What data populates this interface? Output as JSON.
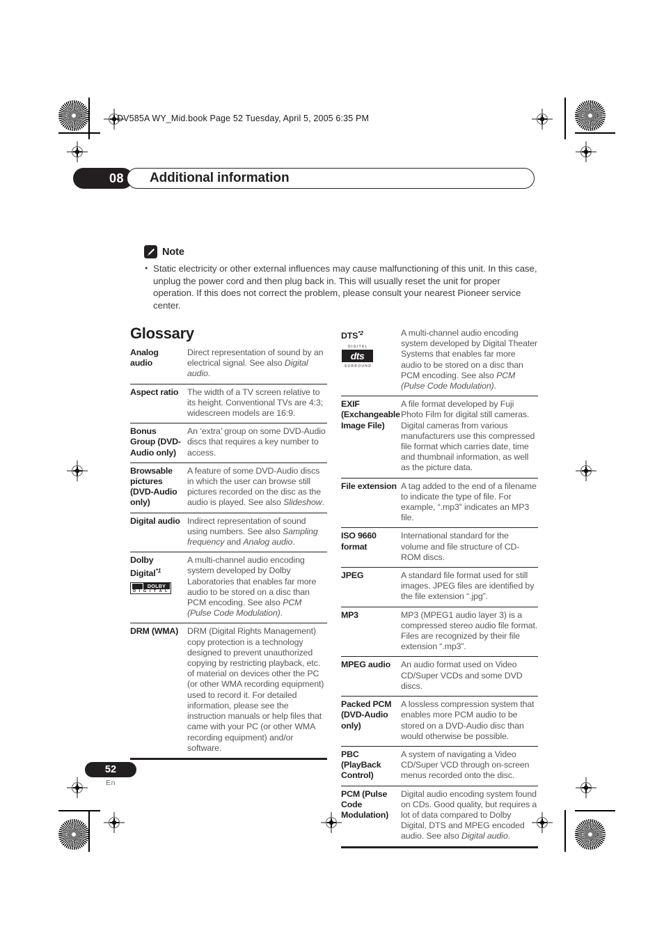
{
  "print_header": {
    "file_line": "DV585A WY_Mid.book  Page 52  Tuesday, April 5, 2005  6:35 PM"
  },
  "chapter": {
    "number": "08",
    "title": "Additional information"
  },
  "note": {
    "heading": "Note",
    "icon": "pencil-note-icon",
    "items": [
      "Static electricity or other external influences may cause malfunctioning of this unit. In this case, unplug the power cord and then plug back in. This will usually reset the unit for proper operation. If this does not correct the problem, please consult your nearest Pioneer service center."
    ]
  },
  "glossary": {
    "title": "Glossary",
    "left_column": [
      {
        "term": "Analog audio",
        "definition_html": "Direct representation of sound by an electrical signal. See also <i>Digital audio</i>."
      },
      {
        "term": "Aspect ratio",
        "definition_html": "The width of a TV screen relative to its height. Conventional TVs are 4:3; widescreen models are 16:9."
      },
      {
        "term": "Bonus Group (DVD-Audio only)",
        "definition_html": "An ‘extra’ group on some DVD-Audio discs that requires a key number to access."
      },
      {
        "term": "Browsable pictures (DVD-Audio only)",
        "definition_html": "A feature of some DVD-Audio discs in which the user can browse still pictures recorded on the disc as the audio is played. See also <i>Slideshow</i>."
      },
      {
        "term": "Digital audio",
        "definition_html": "Indirect representation of sound using numbers. See also <i>Sampling frequency</i> and <i>Analog audio</i>."
      },
      {
        "term": "Dolby Digital",
        "term_footnote": "*1",
        "logo": "dolby-digital-logo",
        "logo_text": {
          "mark": "DOLBY",
          "sub": "D I G I T A L"
        },
        "definition_html": "A multi-channel audio encoding system developed by Dolby Laboratories that enables far more audio to be stored on a disc than PCM encoding. See also <i>PCM (Pulse Code Modulation)</i>."
      },
      {
        "term": "DRM  (WMA)",
        "definition_html": "DRM (Digital Rights Management) copy protection is a technology designed to prevent unauthorized copying by restricting playback, etc. of material on devices other the PC (or other WMA recording equipment) used to record it. For detailed information, please see the instruction manuals or help files that came with your PC (or other WMA recording equipment) and/or software."
      }
    ],
    "right_column": [
      {
        "term": "DTS",
        "term_footnote": "*2",
        "logo": "dts-digital-surround-logo",
        "logo_text": {
          "top": "DIGITAL",
          "mark": "dts",
          "bottom": "SURROUND"
        },
        "definition_html": "A multi-channel audio encoding system developed by Digital Theater Systems that enables far more audio to be stored on a disc than PCM encoding. See also <i>PCM (Pulse Code Modulation)</i>."
      },
      {
        "term": "EXIF (Exchangeable Image File)",
        "definition_html": "A file format developed by Fuji Photo Film for digital still cameras. Digital cameras from various manufacturers use this compressed file format which carries date, time and thumbnail information, as well as the picture data."
      },
      {
        "term": "File extension",
        "definition_html": "A tag added to the end of a filename to indicate the type of file. For example, “.mp3” indicates an MP3 file."
      },
      {
        "term": "ISO 9660 format",
        "definition_html": "International standard for the volume and file structure of CD-ROM discs."
      },
      {
        "term": "JPEG",
        "definition_html": "A standard file format used for still images. JPEG files are identified by the file extension “.jpg”."
      },
      {
        "term": "MP3",
        "definition_html": "MP3 (MPEG1 audio layer 3) is a compressed stereo audio file format. Files are recognized by their file extension “.mp3”."
      },
      {
        "term": "MPEG audio",
        "definition_html": "An audio format used on Video CD/Super VCDs and some DVD discs."
      },
      {
        "term": "Packed PCM (DVD-Audio only)",
        "definition_html": "A lossless compression system that enables more PCM audio to be stored on a DVD-Audio disc than would otherwise be possible."
      },
      {
        "term": "PBC (PlayBack Control)",
        "definition_html": "A system of navigating a Video CD/Super VCD through on-screen menus recorded onto the disc."
      },
      {
        "term": "PCM (Pulse Code Modulation)",
        "definition_html": "Digital audio encoding system found on CDs. Good quality, but requires a lot of data compared to Dolby Digital, DTS and MPEG encoded audio. See also <i>Digital audio</i>."
      }
    ]
  },
  "footer": {
    "page_number": "52",
    "language_code": "En"
  }
}
